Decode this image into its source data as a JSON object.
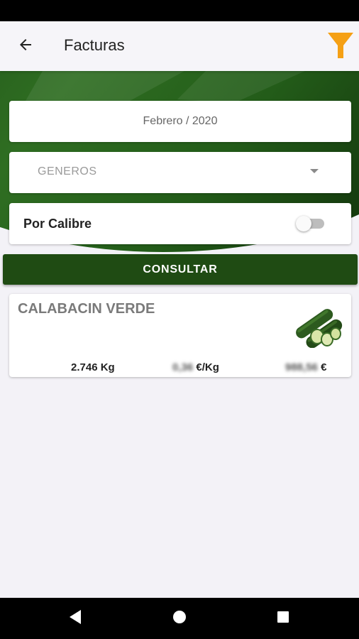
{
  "app_bar": {
    "title": "Facturas",
    "back_icon": "arrow-left-icon",
    "filter_icon": "funnel-filter-icon",
    "filter_color": "#f5a015"
  },
  "form": {
    "date_value": "Febrero / 2020",
    "genre_placeholder": "GENEROS",
    "calibre_label": "Por Calibre",
    "calibre_enabled": false,
    "consult_label": "CONSULTAR"
  },
  "results": [
    {
      "name": "CALABACIN VERDE",
      "image_icon": "zucchini-image",
      "quantity": "2.746 Kg",
      "price_value": "0,36",
      "price_unit": "€/Kg",
      "total_value": "988,56",
      "total_unit": "€"
    }
  ],
  "colors": {
    "brand_green": "#1f4b13",
    "accent_orange": "#f5a015",
    "background": "#f3f2f7"
  },
  "nav": {
    "back_icon": "triangle-back-icon",
    "home_icon": "circle-home-icon",
    "recents_icon": "square-recents-icon"
  }
}
